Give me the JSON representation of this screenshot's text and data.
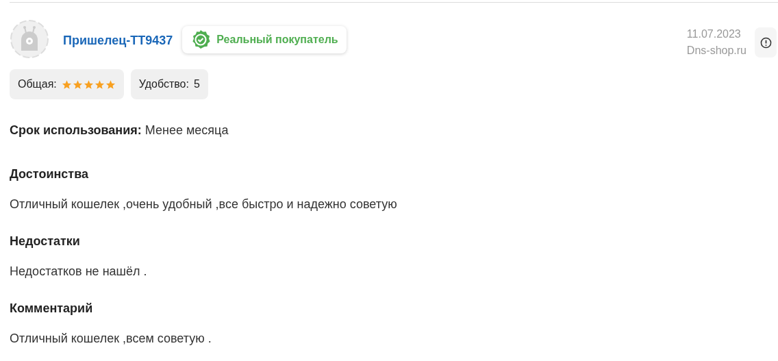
{
  "review": {
    "author": "Пришелец-TT9437",
    "badge": "Реальный покупатель",
    "date": "11.07.2023",
    "source": "Dns-shop.ru",
    "ratings": [
      {
        "kind": "stars",
        "label": "Общая:",
        "stars": 5
      },
      {
        "kind": "text",
        "label": "Удобство:",
        "value": "5"
      }
    ],
    "usage": {
      "label": "Срок использования:",
      "value": "Менее месяца"
    },
    "sections": [
      {
        "title": "Достоинства",
        "text": "Отличный кошелек ,очень удобный ,все быстро и надежно советую"
      },
      {
        "title": "Недостатки",
        "text": "Недостатков не нашёл ."
      },
      {
        "title": "Комментарий",
        "text": "Отличный кошелек ,всем советую ."
      }
    ]
  }
}
